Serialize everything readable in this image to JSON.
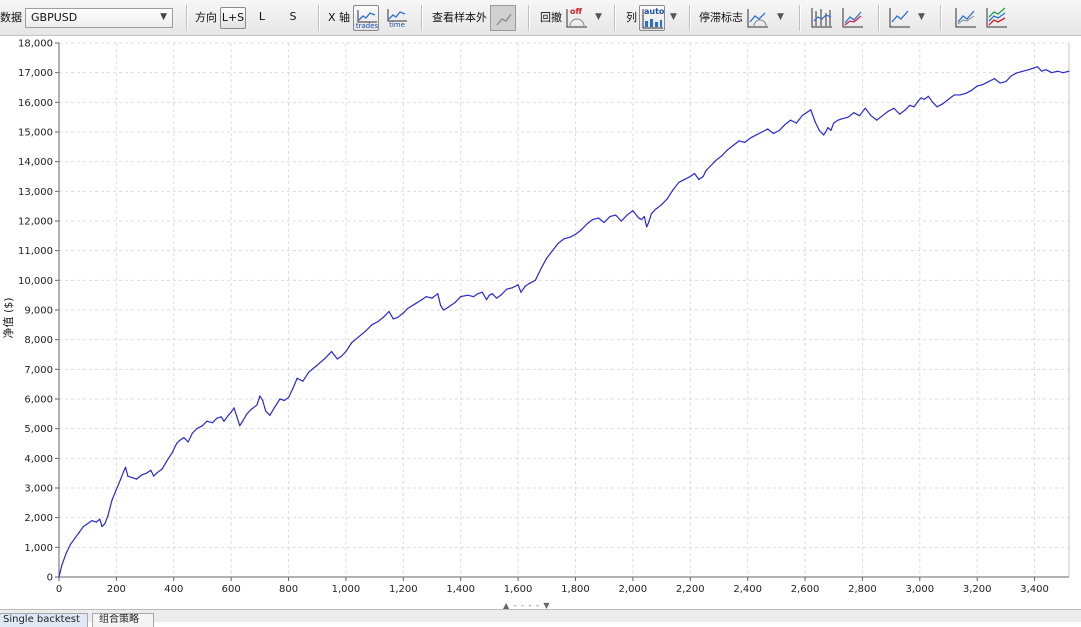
{
  "toolbar": {
    "data_label": "数据",
    "symbol_value": "GBPUSD",
    "direction_label": "方向",
    "direction_options": [
      "L+S",
      "L",
      "S"
    ],
    "xaxis_label": "X 轴",
    "xaxis_trades_label": "trades",
    "xaxis_time_label": "time",
    "out_of_sample_label": "查看样本外",
    "drawdown_label": "回撤",
    "drawdown_off_label": "off",
    "columns_label": "列",
    "columns_auto_label": "auto",
    "stagnation_label": "停滞标志"
  },
  "tabs": [
    "Single backtest",
    "组合策略"
  ],
  "chart_data": {
    "type": "line",
    "title": "",
    "xlabel": "",
    "ylabel": "净值 ($)",
    "xlim": [
      0,
      3520
    ],
    "ylim": [
      0,
      18000
    ],
    "x_ticks": [
      0,
      200,
      400,
      600,
      800,
      1000,
      1200,
      1400,
      1600,
      1800,
      2000,
      2200,
      2400,
      2600,
      2800,
      3000,
      3200,
      3400
    ],
    "x_tick_labels": [
      "0",
      "200",
      "400",
      "600",
      "800",
      "1,000",
      "1,200",
      "1,400",
      "1,600",
      "1,800",
      "2,000",
      "2,200",
      "2,400",
      "2,600",
      "2,800",
      "3,000",
      "3,200",
      "3,400"
    ],
    "y_ticks": [
      0,
      1000,
      2000,
      3000,
      4000,
      5000,
      6000,
      7000,
      8000,
      9000,
      10000,
      11000,
      12000,
      13000,
      14000,
      15000,
      16000,
      17000,
      18000
    ],
    "y_tick_labels": [
      "0",
      "1,000",
      "2,000",
      "3,000",
      "4,000",
      "5,000",
      "6,000",
      "7,000",
      "8,000",
      "9,000",
      "10,000",
      "11,000",
      "12,000",
      "13,000",
      "14,000",
      "15,000",
      "16,000",
      "17,000",
      "18,000"
    ],
    "grid": true,
    "line_color": "#2a2ad0",
    "series": [
      {
        "x": [
          0,
          10,
          25,
          40,
          55,
          70,
          85,
          100,
          115,
          130,
          142,
          150,
          160,
          170,
          185,
          200,
          215,
          225,
          232,
          240,
          255,
          270,
          290,
          305,
          320,
          330,
          340,
          360,
          375,
          395,
          410,
          420,
          435,
          450,
          465,
          480,
          500,
          515,
          535,
          550,
          565,
          575,
          590,
          600,
          610,
          630,
          640,
          655,
          670,
          690,
          700,
          710,
          720,
          735,
          750,
          770,
          785,
          800,
          815,
          830,
          850,
          870,
          895,
          925,
          950,
          970,
          985,
          1000,
          1020,
          1045,
          1070,
          1090,
          1110,
          1130,
          1150,
          1165,
          1180,
          1200,
          1215,
          1240,
          1265,
          1280,
          1300,
          1320,
          1330,
          1340,
          1350,
          1365,
          1380,
          1400,
          1425,
          1445,
          1460,
          1475,
          1490,
          1500,
          1510,
          1525,
          1540,
          1560,
          1580,
          1600,
          1610,
          1625,
          1640,
          1660,
          1680,
          1700,
          1720,
          1740,
          1760,
          1780,
          1800,
          1820,
          1840,
          1860,
          1880,
          1900,
          1920,
          1940,
          1960,
          1980,
          2000,
          2020,
          2030,
          2040,
          2048,
          2055,
          2065,
          2080,
          2100,
          2120,
          2140,
          2160,
          2180,
          2200,
          2215,
          2230,
          2245,
          2255,
          2270,
          2290,
          2310,
          2330,
          2350,
          2370,
          2390,
          2410,
          2430,
          2450,
          2470,
          2490,
          2510,
          2530,
          2550,
          2570,
          2590,
          2605,
          2620,
          2635,
          2650,
          2665,
          2672,
          2680,
          2690,
          2700,
          2715,
          2730,
          2750,
          2770,
          2790,
          2810,
          2830,
          2850,
          2870,
          2890,
          2910,
          2930,
          2950,
          2965,
          2980,
          2995,
          3005,
          3015,
          3030,
          3045,
          3060,
          3080,
          3100,
          3120,
          3140,
          3160,
          3180,
          3200,
          3220,
          3240,
          3260,
          3280,
          3300,
          3320,
          3340,
          3360,
          3380,
          3395,
          3410,
          3425,
          3440,
          3460,
          3480,
          3500,
          3520
        ],
        "y": [
          0,
          400,
          800,
          1100,
          1300,
          1500,
          1700,
          1800,
          1900,
          1850,
          1950,
          1700,
          1800,
          2050,
          2600,
          2950,
          3300,
          3550,
          3700,
          3400,
          3350,
          3300,
          3450,
          3500,
          3600,
          3400,
          3500,
          3650,
          3900,
          4200,
          4500,
          4600,
          4700,
          4550,
          4850,
          5000,
          5100,
          5250,
          5200,
          5350,
          5400,
          5250,
          5450,
          5550,
          5700,
          5100,
          5250,
          5500,
          5650,
          5800,
          6100,
          5950,
          5600,
          5450,
          5700,
          6000,
          5950,
          6050,
          6350,
          6700,
          6600,
          6900,
          7100,
          7350,
          7600,
          7350,
          7450,
          7600,
          7900,
          8100,
          8300,
          8500,
          8600,
          8750,
          8950,
          8700,
          8750,
          8900,
          9050,
          9200,
          9350,
          9450,
          9400,
          9550,
          9150,
          9000,
          9050,
          9150,
          9250,
          9450,
          9500,
          9450,
          9550,
          9600,
          9350,
          9500,
          9550,
          9400,
          9500,
          9700,
          9750,
          9850,
          9600,
          9800,
          9900,
          10000,
          10400,
          10750,
          11000,
          11250,
          11400,
          11450,
          11550,
          11700,
          11900,
          12050,
          12100,
          11950,
          12150,
          12200,
          12000,
          12200,
          12350,
          12100,
          12050,
          12150,
          11800,
          11950,
          12250,
          12400,
          12550,
          12750,
          13050,
          13300,
          13400,
          13500,
          13600,
          13400,
          13500,
          13700,
          13850,
          14050,
          14200,
          14400,
          14550,
          14700,
          14650,
          14800,
          14900,
          15000,
          15100,
          14950,
          15050,
          15250,
          15400,
          15300,
          15550,
          15650,
          15750,
          15350,
          15050,
          14900,
          15000,
          15150,
          15050,
          15300,
          15400,
          15450,
          15500,
          15650,
          15550,
          15800,
          15550,
          15400,
          15550,
          15700,
          15800,
          15600,
          15750,
          15900,
          15850,
          16050,
          16150,
          16100,
          16200,
          16000,
          15850,
          15950,
          16100,
          16250,
          16250,
          16300,
          16400,
          16550,
          16600,
          16700,
          16800,
          16650,
          16700,
          16900,
          17000,
          17050,
          17100,
          17150,
          17200,
          17050,
          17100,
          17000,
          17050,
          17000,
          17050
        ]
      }
    ]
  }
}
